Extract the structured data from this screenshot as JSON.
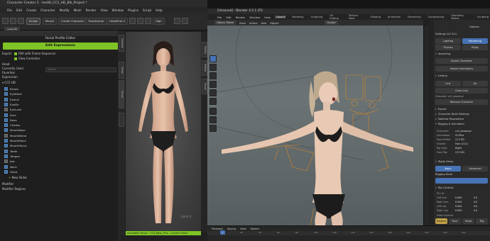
{
  "cc": {
    "title": "Character Creator 5 - tes06_CC5_HD_Blk_Project *",
    "menu": [
      "File",
      "Edit",
      "Create",
      "Character",
      "Modify",
      "Mesh",
      "Render",
      "View",
      "Window",
      "Plugins",
      "Script",
      "Help"
    ],
    "toolbar": {
      "sculpt": "Sculpt",
      "morph": "Morph",
      "create_character": "Create Character",
      "transformer": "Transformer",
      "vendor": "HeadShot 2",
      "hd_label": "AvatarHD",
      "quality": "High"
    },
    "panel_header": "Facial Profile Editor",
    "edit_expressions": "Edit Expressions",
    "options": [
      {
        "label": "FBX with Frame Sequence",
        "checked": true
      },
      {
        "label": "View Controller",
        "checked": true
      }
    ],
    "sidebar_labels": [
      "Export",
      "Head",
      "Currently Used",
      "Favorites",
      "Expression"
    ],
    "search_placeholder": "Search",
    "group": "CC5 HD",
    "tree_items": [
      "Brows",
      "EyeBlink",
      "EyeLid",
      "EyeDir",
      "EyeLash",
      "Ears",
      "Nose",
      "Cheeks",
      "MouthBase",
      "MouthBlend",
      "MouthMove",
      "MouthSticks",
      "Teeth",
      "Tongue",
      "Jaw",
      "Neck",
      "Head"
    ],
    "new_slider": "New Slider",
    "footer_items": [
      "Modifier",
      "Modifier Regions"
    ],
    "viewport_watermark": "Build 0",
    "side_tabs_left": [
      "Content",
      "Scene",
      "Visual"
    ],
    "side_tabs_right": [
      "Modify",
      "Motion",
      "Visual"
    ],
    "anim_bar": "Animation Player : CC5_Base_Plus - Current Frame"
  },
  "blender": {
    "title": "[Unsaved] - Blender 4.5.1 LTS",
    "menu": [
      "File",
      "Edit",
      "Render",
      "Window",
      "Help"
    ],
    "workspaces": [
      "Layout",
      "Modeling",
      "Sculpting",
      "UV Editing",
      "Texture Paint",
      "Shading",
      "Animation",
      "Rendering",
      "Compositing",
      "Geometry Nodes",
      "Scripting"
    ],
    "active_workspace": "Layout",
    "viewport_header": [
      "Object Mode",
      "View",
      "Select",
      "Add",
      "Object"
    ],
    "transform_orientation": "Global",
    "props": {
      "options_label": "Options",
      "settings_title": "Settings (v2.3.0)",
      "tabs_row1": [
        "Lighting",
        "Rendering"
      ],
      "tabs_row2": [
        "Physics",
        "Rigify"
      ],
      "importing": "Importing",
      "import_character": "Import Character",
      "import_animations": "Import Animations",
      "linking": "Linking",
      "link_btn": "Link",
      "go_btn": "Go",
      "close_link": "Close Link",
      "remove_label": "Character: cc5_sessional",
      "remove_btn": "Remove Character",
      "sections": [
        "Export",
        "Character Build Settings",
        "Material Parameters",
        "Rigging & Animation"
      ],
      "kv": [
        {
          "k": "Character:",
          "v": "cc5_sessional"
        },
        {
          "k": "Generation:",
          "v": "iCCPlus"
        },
        {
          "k": "Face Profile:",
          "v": "CC5 HD"
        },
        {
          "k": "Viseme:",
          "v": "Face (CC4)"
        },
        {
          "k": "Rig Type:",
          "v": "Rigify"
        },
        {
          "k": "Face Rig:",
          "v": "CC5 HD"
        }
      ],
      "rigify_setup": "Rigify Setup",
      "basic": "Basic",
      "advanced": "Advanced",
      "rigging_done": "Rigging Done",
      "rig_controls": "Rig Controls",
      "fk_ik": "FK / IK",
      "limbs": [
        {
          "name": "Left Arm",
          "a": "0.000",
          "b": "0.0"
        },
        {
          "name": "Right Arm",
          "a": "0.000",
          "b": "0.0"
        },
        {
          "name": "Left Leg",
          "a": "0.000",
          "b": "0.0"
        },
        {
          "name": "Right Leg",
          "a": "0.000",
          "b": "0.0"
        }
      ],
      "head_controls": "Head Controls",
      "head_buttons": [
        "Trackers",
        "Face",
        "Head",
        "Rig"
      ]
    },
    "timeline": {
      "header": [
        "Playback",
        "Keying",
        "View",
        "Marker"
      ],
      "frame": "1",
      "ticks": [
        "1",
        "20",
        "40",
        "60",
        "80",
        "100",
        "120",
        "140",
        "160",
        "180",
        "200",
        "220",
        "240",
        "250"
      ]
    }
  }
}
